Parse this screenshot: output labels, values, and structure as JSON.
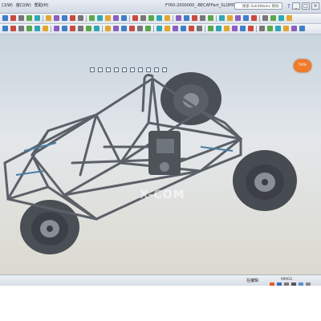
{
  "titlebar": {
    "menu": [
      "口(W)",
      "窗口(W)",
      "帮助(H)"
    ],
    "document_title": "FY60-2000000_-BECAFPart_SLDPRT",
    "search_placeholder": "搜索 SolidWorks 帮助",
    "window_buttons": [
      "_",
      "□",
      "×"
    ]
  },
  "viewport": {
    "watermark": "X-COM",
    "badge": "59%"
  },
  "statusbar": {
    "text": "在编辑",
    "units": "MMGS"
  },
  "colors": {
    "frame": "#6b7078",
    "tire": "#4a4e55",
    "rim": "#8a8f96",
    "badge": "#f07b2b"
  }
}
